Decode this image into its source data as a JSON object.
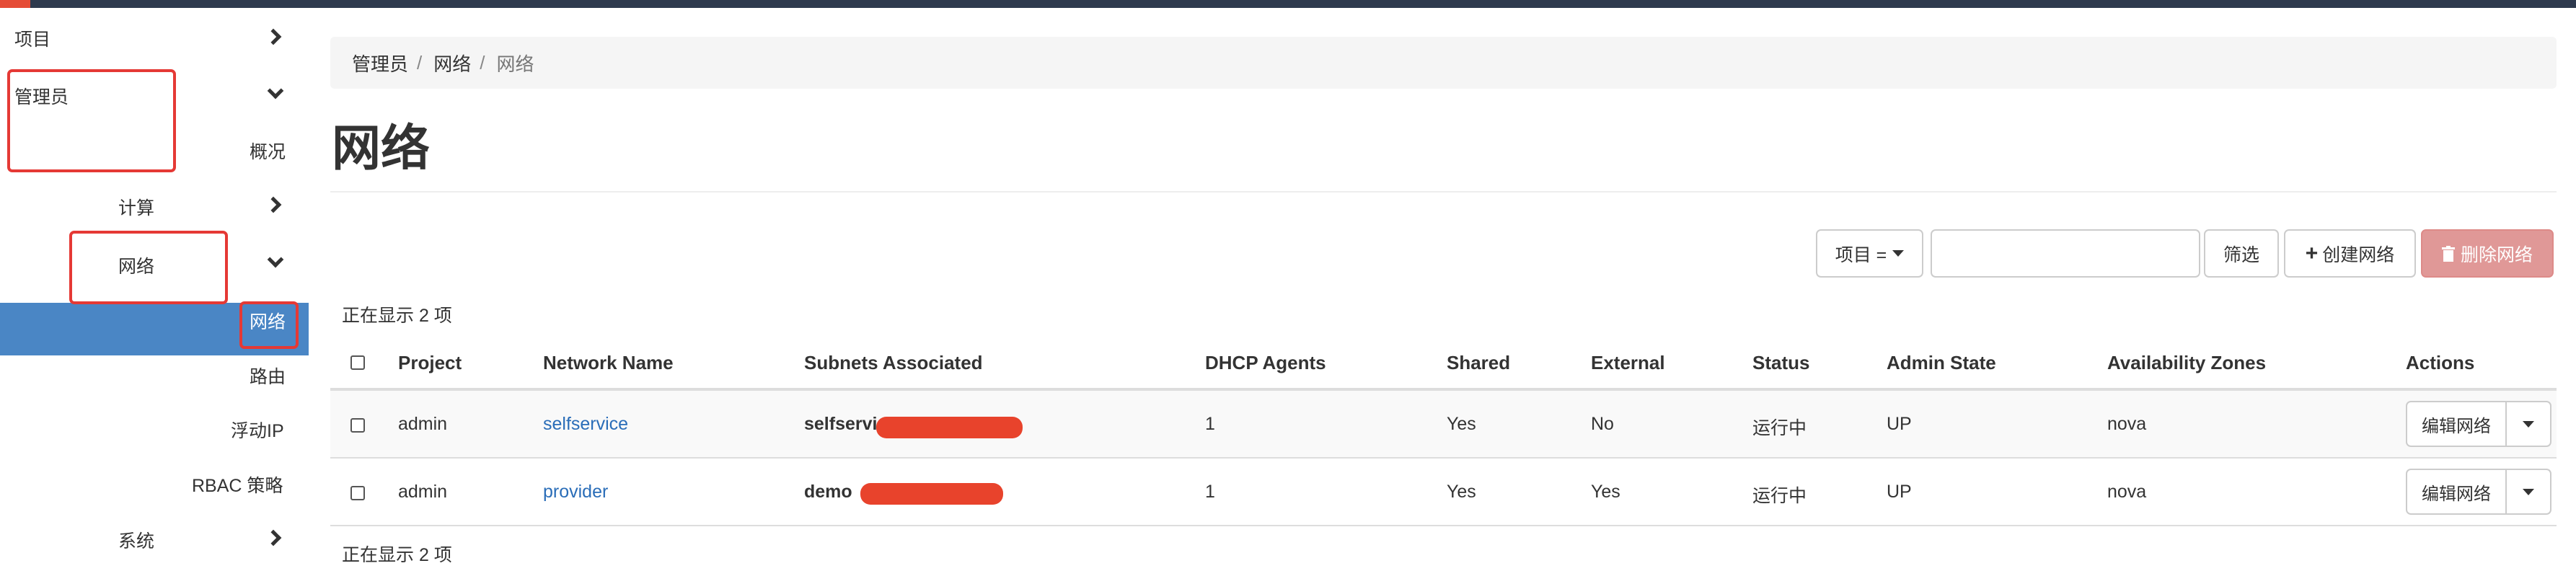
{
  "sidebar": {
    "items": [
      {
        "label": "项目"
      },
      {
        "label": "管理员"
      },
      {
        "label": "概况"
      },
      {
        "label": "计算"
      },
      {
        "label": "网络"
      },
      {
        "label": "网络"
      },
      {
        "label": "路由"
      },
      {
        "label": "浮动IP"
      },
      {
        "label": "RBAC 策略"
      },
      {
        "label": "系统"
      }
    ]
  },
  "breadcrumb": {
    "items": [
      "管理员",
      "网络",
      "网络"
    ],
    "separator": "/"
  },
  "page": {
    "title": "网络"
  },
  "toolbar": {
    "filter_field": "项目 =",
    "filter_value": "",
    "filter_button": "筛选",
    "create_button": "创建网络",
    "delete_button": "删除网络"
  },
  "table": {
    "count_top": "正在显示 2 项",
    "count_bottom": "正在显示 2 项",
    "columns": [
      "Project",
      "Network Name",
      "Subnets Associated",
      "DHCP Agents",
      "Shared",
      "External",
      "Status",
      "Admin State",
      "Availability Zones",
      "Actions"
    ],
    "rows": [
      {
        "project": "admin",
        "network_name": "selfservice",
        "subnets": "selfservic",
        "dhcp": "1",
        "shared": "Yes",
        "external": "No",
        "status": "运行中",
        "admin_state": "UP",
        "az": "nova",
        "action": "编辑网络"
      },
      {
        "project": "admin",
        "network_name": "provider",
        "subnets": "demo",
        "dhcp": "1",
        "shared": "Yes",
        "external": "Yes",
        "status": "运行中",
        "admin_state": "UP",
        "az": "nova",
        "action": "编辑网络"
      }
    ]
  },
  "colors": {
    "accent": "#4a86c5",
    "danger": "#e09897",
    "highlight": "#e53935",
    "link": "#2a6db8",
    "topbar": "#2e3a4e"
  }
}
